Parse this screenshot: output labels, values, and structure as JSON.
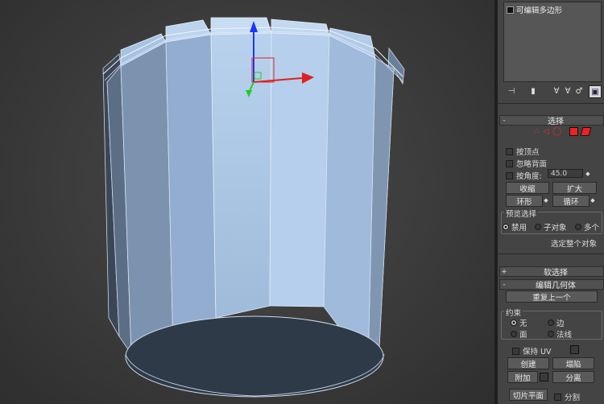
{
  "modifier_stack": {
    "item": "可编辑多边形"
  },
  "stack_toolbar": [
    "pin-stack-icon",
    "show-end-result-icon",
    "make-unique-icon",
    "remove-modifier-icon",
    "configure-modifier-sets-icon"
  ],
  "selection": {
    "title": "选择",
    "by_vertex": "按顶点",
    "ignore_backfacing": "忽略背面",
    "by_angle": "按角度:",
    "angle_value": "45.0",
    "shrink": "收缩",
    "grow": "扩大",
    "ring": "环形",
    "loop": "循环",
    "preview": {
      "title": "预览选择",
      "disabled": "禁用",
      "subobject": "子对象",
      "multi": "多个"
    },
    "status": "选定整个对象"
  },
  "soft_selection": {
    "title": "软选择"
  },
  "edit_geometry": {
    "title": "编辑几何体",
    "repeat_last": "重复上一个",
    "constraints": {
      "title": "约束",
      "none": "无",
      "edge": "边",
      "face": "面",
      "normal": "法线"
    },
    "preserve_uv": "保持 UV",
    "create": "创建",
    "collapse": "塌陷",
    "attach": "附加",
    "detach": "分离",
    "slice_plane": "切片平面",
    "split": "分割"
  },
  "colors": {
    "mesh_fill": "#a9c7e6",
    "mesh_dark": "#54657a",
    "bottom_face": "#2f3a48",
    "gizmo_x": "#e02020",
    "gizmo_y": "#22cc22",
    "gizmo_z": "#1a35ff"
  }
}
